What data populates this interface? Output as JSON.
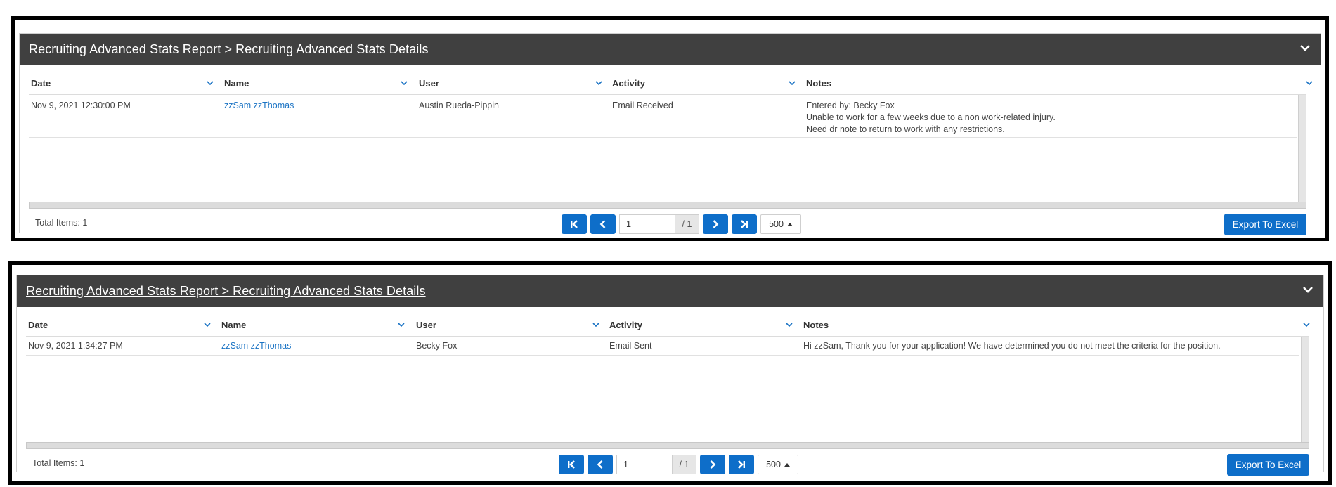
{
  "reports": [
    {
      "title": "Recruiting Advanced Stats Report > Recruiting Advanced Stats Details",
      "columns": [
        "Date",
        "Name",
        "User",
        "Activity",
        "Notes"
      ],
      "rows": [
        {
          "date": "Nov 9, 2021 12:30:00 PM",
          "name": "zzSam zzThomas",
          "user": "Austin Rueda-Pippin",
          "activity": "Email Received",
          "notes": [
            "Entered by: Becky Fox",
            "Unable to work for a few weeks due to a non work-related injury.",
            "Need dr note to return to work with any restrictions."
          ]
        }
      ],
      "total_items": "Total Items: 1",
      "page_value": "1",
      "page_total": "/ 1",
      "page_size": "500",
      "export_label": "Export To Excel"
    },
    {
      "title": "Recruiting Advanced Stats Report > Recruiting Advanced Stats Details",
      "columns": [
        "Date",
        "Name",
        "User",
        "Activity",
        "Notes"
      ],
      "rows": [
        {
          "date": "Nov 9, 2021 1:34:27 PM",
          "name": "zzSam zzThomas",
          "user": "Becky Fox",
          "activity": "Email Sent",
          "notes": [
            "Hi zzSam, Thank you for your application!  We have determined you do not meet the criteria for the position."
          ]
        }
      ],
      "total_items": "Total Items: 1",
      "page_value": "1",
      "page_total": "/ 1",
      "page_size": "500",
      "export_label": "Export To Excel"
    }
  ],
  "colors": {
    "header_bg": "#404040",
    "accent": "#0e6ec9",
    "link": "#1a73c4"
  },
  "icons": [
    "chevron-down-icon",
    "first-page-icon",
    "previous-page-icon",
    "next-page-icon",
    "last-page-icon",
    "caret-up-icon"
  ]
}
